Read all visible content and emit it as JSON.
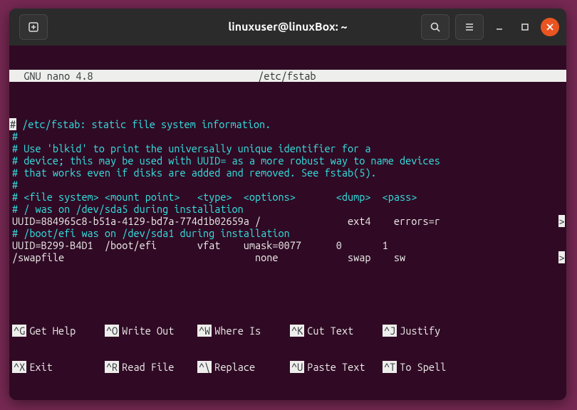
{
  "titlebar": {
    "title": "linuxuser@linuxBox: ~"
  },
  "nano": {
    "app": "  GNU nano 4.8",
    "file": "/etc/fstab"
  },
  "lines": [
    {
      "cls": "c-comment",
      "first": true,
      "text": " /etc/fstab: static file system information."
    },
    {
      "cls": "c-comment",
      "text": "#"
    },
    {
      "cls": "c-comment",
      "text": "# Use 'blkid' to print the universally unique identifier for a"
    },
    {
      "cls": "c-comment",
      "text": "# device; this may be used with UUID= as a more robust way to name devices"
    },
    {
      "cls": "c-comment",
      "text": "# that works even if disks are added and removed. See fstab(5)."
    },
    {
      "cls": "c-comment",
      "text": "#"
    },
    {
      "cls": "c-comment",
      "text": "# <file system> <mount point>   <type>  <options>       <dump>  <pass>"
    },
    {
      "cls": "c-comment",
      "text": "# / was on /dev/sda5 during installation"
    },
    {
      "cls": "c-plain",
      "text": "UUID=884965c8-b51a-4129-bd7a-774d1b02659a /               ext4    errors=r",
      "trunc": ">"
    },
    {
      "cls": "c-comment",
      "text": "# /boot/efi was on /dev/sda1 during installation"
    },
    {
      "cls": "c-plain",
      "text": "UUID=B299-B4D1  /boot/efi       vfat    umask=0077      0       1"
    },
    {
      "cls": "c-plain",
      "text": "/swapfile                                 none            swap    sw       ",
      "trunc": ">"
    }
  ],
  "shortcuts": {
    "row1": [
      {
        "key": "^G",
        "label": "Get Help"
      },
      {
        "key": "^O",
        "label": "Write Out"
      },
      {
        "key": "^W",
        "label": "Where Is"
      },
      {
        "key": "^K",
        "label": "Cut Text"
      },
      {
        "key": "^J",
        "label": "Justify"
      }
    ],
    "row2": [
      {
        "key": "^X",
        "label": "Exit"
      },
      {
        "key": "^R",
        "label": "Read File"
      },
      {
        "key": "^\\",
        "label": "Replace"
      },
      {
        "key": "^U",
        "label": "Paste Text"
      },
      {
        "key": "^T",
        "label": "To Spell"
      }
    ]
  }
}
